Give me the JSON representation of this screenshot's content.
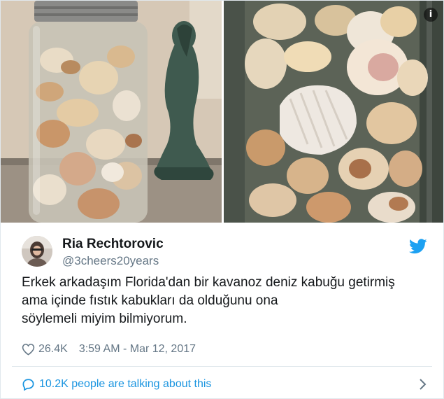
{
  "tweet": {
    "author_name": "Ria Rechtorovic",
    "author_handle": "@3cheers20years",
    "text": "Erkek arkadaşım Florida'dan bir kavanoz deniz kabuğu getirmiş\nama içinde fıstık kabukları da olduğunu ona\nsöylemeli miyim bilmiyorum.",
    "likes": "26.4K",
    "timestamp": "3:59 AM - Mar 12, 2017",
    "conversation": "10.2K people are talking about this"
  },
  "media": {
    "info_glyph": "i"
  },
  "icons": {
    "twitter": "twitter-bird-icon",
    "like": "heart-icon",
    "reply": "speech-bubble-icon",
    "more": "chevron-right-icon",
    "info": "info-icon"
  },
  "colors": {
    "brand_blue": "#1da1f2",
    "link_blue": "#1b95e0",
    "text": "#14171a",
    "muted": "#657786",
    "border": "#e1e8ed"
  }
}
